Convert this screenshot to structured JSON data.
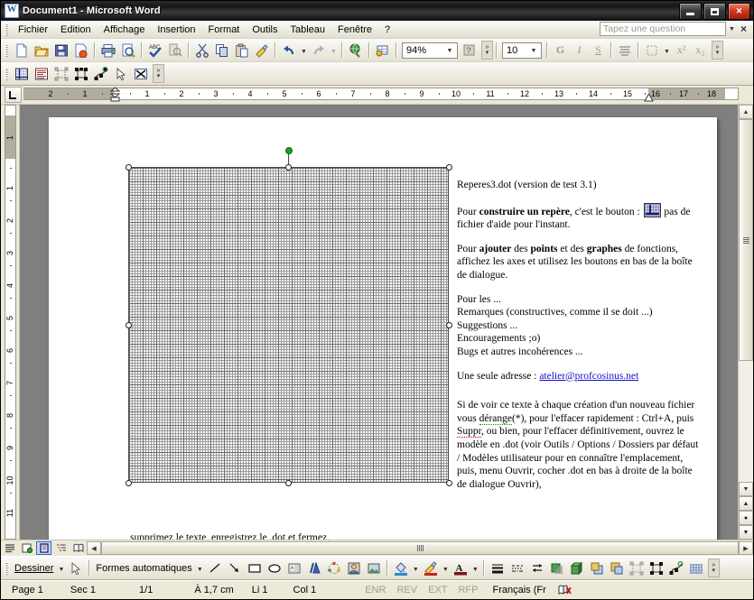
{
  "window": {
    "title": "Document1 - Microsoft Word",
    "app_icon": "word-document-icon",
    "minimize_label": "minimize",
    "maximize_label": "maximize",
    "close_label": "close"
  },
  "menubar": {
    "items": [
      {
        "label": "Fichier",
        "accel": "F"
      },
      {
        "label": "Edition",
        "accel": "E"
      },
      {
        "label": "Affichage",
        "accel": "A"
      },
      {
        "label": "Insertion",
        "accel": "I"
      },
      {
        "label": "Format",
        "accel": "t"
      },
      {
        "label": "Outils",
        "accel": "O"
      },
      {
        "label": "Tableau",
        "accel": "b"
      },
      {
        "label": "Fenêtre",
        "accel": "ê"
      },
      {
        "label": "?",
        "accel": "?"
      }
    ],
    "help_box_placeholder": "Tapez une question",
    "close_document_label": "×"
  },
  "standard_toolbar": {
    "buttons": [
      {
        "name": "new-document-icon",
        "title": "Nouveau document"
      },
      {
        "name": "open-folder-icon",
        "title": "Ouvrir"
      },
      {
        "name": "save-icon",
        "title": "Enregistrer"
      },
      {
        "name": "mail-recipient-icon",
        "title": "Courrier électronique"
      },
      {
        "name": "print-icon",
        "title": "Imprimer"
      },
      {
        "name": "print-preview-icon",
        "title": "Aperçu avant impression"
      },
      {
        "name": "spelling-check-icon",
        "title": "Grammaire et orthographe"
      },
      {
        "name": "research-icon",
        "title": "Recherche"
      },
      {
        "name": "cut-scissors-icon",
        "title": "Couper"
      },
      {
        "name": "copy-icon",
        "title": "Copier"
      },
      {
        "name": "paste-icon",
        "title": "Coller"
      },
      {
        "name": "format-painter-brush-icon",
        "title": "Reproduire la mise en forme"
      },
      {
        "name": "undo-arrow-icon",
        "title": "Annuler"
      },
      {
        "name": "redo-arrow-icon",
        "title": "Répéter"
      },
      {
        "name": "hyperlink-globe-icon",
        "title": "Insérer un lien hypertexte"
      },
      {
        "name": "tables-borders-icon",
        "title": "Tableaux et bordures"
      }
    ],
    "zoom_value": "94%",
    "zoom_label": "Zoom",
    "help_button": "help-question-icon"
  },
  "formatting_toolbar": {
    "font_size_value": "10",
    "bold_label": "G",
    "italic_label": "I",
    "underline_label": "S",
    "align_label": "align-justify-icon",
    "borders_label": "borders-icon",
    "superscript_label": "x²",
    "subscript_label": "x₂"
  },
  "custom_toolbar": {
    "buttons": [
      {
        "name": "insert-grid-repere-icon",
        "title": "Insérer un repère"
      },
      {
        "name": "text-frame-icon",
        "title": "Cadre de texte"
      },
      {
        "name": "group-objects-icon",
        "title": "Grouper"
      },
      {
        "name": "select-nodes-icon",
        "title": "Modifier les points"
      },
      {
        "name": "edit-points-icon",
        "title": "Points du graphe"
      },
      {
        "name": "select-arrow-icon",
        "title": "Sélectionner les objets"
      },
      {
        "name": "delete-object-icon",
        "title": "Supprimer"
      }
    ],
    "overflow_label": "»"
  },
  "ruler": {
    "tab_selector": "tab-left-icon",
    "horizontal_ticks": [
      "2",
      "1",
      "1",
      "2",
      "3",
      "4",
      "5",
      "6",
      "7",
      "8",
      "9",
      "10",
      "11",
      "12",
      "13",
      "14",
      "15",
      "16",
      "17",
      "18"
    ],
    "vertical_ticks": [
      "1",
      "1",
      "2",
      "3",
      "4",
      "5",
      "6",
      "7",
      "8",
      "9",
      "10",
      "11"
    ],
    "left_indent_marker": "left-indent-marker",
    "right_indent_marker": "right-indent-marker"
  },
  "document": {
    "object": {
      "name": "graph-paper-grid-object",
      "selected": true,
      "rotation_handle": "rotation-handle"
    },
    "paragraphs": [
      {
        "id": "p1",
        "runs": [
          {
            "text": "Reperes3.dot (version de test 3.1)",
            "style": "normal"
          }
        ]
      },
      {
        "id": "p2",
        "runs": [
          {
            "text": "Pour ",
            "style": "normal"
          },
          {
            "text": "construire un repère",
            "style": "bold"
          },
          {
            "text": ", c'est le bouton : ",
            "style": "normal"
          },
          {
            "text": "[bouton]",
            "style": "image"
          },
          {
            "text": " pas de fichier d'aide pour l'instant.",
            "style": "normal"
          }
        ]
      },
      {
        "id": "p3",
        "runs": [
          {
            "text": "Pour ",
            "style": "normal"
          },
          {
            "text": "ajouter",
            "style": "bold"
          },
          {
            "text": " des ",
            "style": "normal"
          },
          {
            "text": "points",
            "style": "bold"
          },
          {
            "text": " et des ",
            "style": "normal"
          },
          {
            "text": "graphes",
            "style": "bold"
          },
          {
            "text": " de fonctions, affichez les axes et utilisez les boutons en bas de la boîte de dialogue.",
            "style": "normal"
          }
        ]
      },
      {
        "id": "p4",
        "lines": [
          "Pour les ...",
          "Remarques (constructives, comme il se doit ...)",
          "Suggestions ...",
          "Encouragements ;o)",
          "Bugs et autres incohérences ..."
        ]
      },
      {
        "id": "p5",
        "prefix": "Une seule adresse : ",
        "link_text": "atelier@profcosinus.net"
      },
      {
        "id": "p6",
        "text_before": "Si de voir ce texte à chaque création d'un nouveau fichier vous ",
        "misspelled_1": "dérange",
        "text_mid1": "(*), pour l'effacer rapidement : Ctrl+A, puis ",
        "misspelled_2": "Suppr",
        "text_mid2": ", ou bien, pour l'effacer définitivement, ouvrez le modèle en .dot (voir Outils / Options / Dossiers par défaut / Modèles utilisateur pour en connaître l'emplacement, puis, menu Ouvrir, cocher .dot en bas à droite de la boîte de dialogue Ouvrir),"
      }
    ],
    "bottom_line": "supprimez le texte, enregistrez le .dot et fermez."
  },
  "view_buttons": [
    {
      "name": "normal-view-icon",
      "selected": false
    },
    {
      "name": "web-layout-view-icon",
      "selected": false
    },
    {
      "name": "print-layout-view-icon",
      "selected": true
    },
    {
      "name": "outline-view-icon",
      "selected": false
    },
    {
      "name": "reading-layout-view-icon",
      "selected": false
    }
  ],
  "drawing_toolbar": {
    "draw_menu_label": "Dessiner",
    "draw_menu_accel": "D",
    "select_objects_icon": "select-arrow-icon",
    "autoshapes_label": "Formes automatiques",
    "autoshapes_accel": "m",
    "tools": [
      {
        "name": "line-icon",
        "title": "Ligne"
      },
      {
        "name": "arrow-icon",
        "title": "Flèche"
      },
      {
        "name": "rectangle-icon",
        "title": "Rectangle"
      },
      {
        "name": "oval-icon",
        "title": "Ellipse"
      },
      {
        "name": "text-box-icon",
        "title": "Zone de texte"
      },
      {
        "name": "wordart-icon",
        "title": "WordArt"
      },
      {
        "name": "diagram-icon",
        "title": "Diagramme"
      },
      {
        "name": "clip-art-icon",
        "title": "Image clipart"
      },
      {
        "name": "insert-picture-icon",
        "title": "Insérer une image"
      },
      {
        "name": "fill-color-icon",
        "title": "Couleur de remplissage"
      },
      {
        "name": "line-color-icon",
        "title": "Couleur du trait"
      },
      {
        "name": "font-color-icon",
        "title": "Couleur de police"
      },
      {
        "name": "line-style-icon",
        "title": "Style de trait"
      },
      {
        "name": "dash-style-icon",
        "title": "Style de ligne"
      },
      {
        "name": "arrow-style-icon",
        "title": "Style de flèche"
      },
      {
        "name": "shadow-style-icon",
        "title": "Style d'ombre"
      },
      {
        "name": "threed-style-icon",
        "title": "Style 3D"
      },
      {
        "name": "bring-front-icon",
        "title": "Premier plan"
      },
      {
        "name": "send-back-icon",
        "title": "Arrière-plan"
      },
      {
        "name": "group-icon",
        "title": "Grouper"
      },
      {
        "name": "nodes-icon",
        "title": "Noeuds"
      },
      {
        "name": "edit-points-icon",
        "title": "Modifier les points"
      },
      {
        "name": "grid-icon",
        "title": "Grille"
      }
    ],
    "overflow_label": "»"
  },
  "status_bar": {
    "page_label": "Page",
    "page_value": "1",
    "section_label": "Sec",
    "section_value": "1",
    "pages_value": "1/1",
    "position_label": "À",
    "position_value": "1,7 cm",
    "line_label": "Li",
    "line_value": "1",
    "column_label": "Col",
    "column_value": "1",
    "indicators": [
      "ENR",
      "REV",
      "EXT",
      "RFP"
    ],
    "language": "Français (Fr",
    "spellcheck_icon": "spellcheck-status-icon"
  }
}
